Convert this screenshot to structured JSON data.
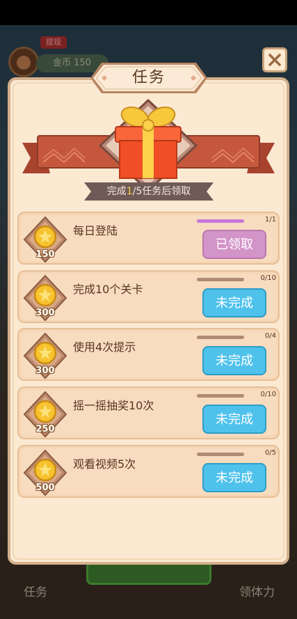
{
  "background": {
    "withdraw_tag": "提现",
    "coins_label": "金币 150",
    "bottom_left_label": "任务",
    "bottom_right_label": "领体力"
  },
  "dialog": {
    "title": "任务",
    "claim": {
      "prefix": "完成",
      "highlight": "1",
      "suffix": "/5任务后领取"
    },
    "tasks": [
      {
        "name": "每日登陆",
        "reward": "150",
        "progress_text": "1/1",
        "progress": 1.0,
        "status": "已领取",
        "state": "claimed"
      },
      {
        "name": "完成10个关卡",
        "reward": "300",
        "progress_text": "0/10",
        "progress": 0.0,
        "status": "未完成",
        "state": "incomplete"
      },
      {
        "name": "使用4次提示",
        "reward": "300",
        "progress_text": "0/4",
        "progress": 0.0,
        "status": "未完成",
        "state": "incomplete"
      },
      {
        "name": "摇一摇抽奖10次",
        "reward": "250",
        "progress_text": "0/10",
        "progress": 0.0,
        "status": "未完成",
        "state": "incomplete"
      },
      {
        "name": "观看视频5次",
        "reward": "500",
        "progress_text": "0/5",
        "progress": 0.0,
        "status": "未完成",
        "state": "incomplete"
      }
    ]
  },
  "icons": {
    "close": "close-icon",
    "gift": "gift-box-icon",
    "coin": "gold-coin-icon"
  },
  "colors": {
    "panel_bg": "#fbe9d2",
    "claimed_button": "#d394c8",
    "incomplete_button": "#4fc2ec",
    "progress_fill": "#c77ad8"
  }
}
